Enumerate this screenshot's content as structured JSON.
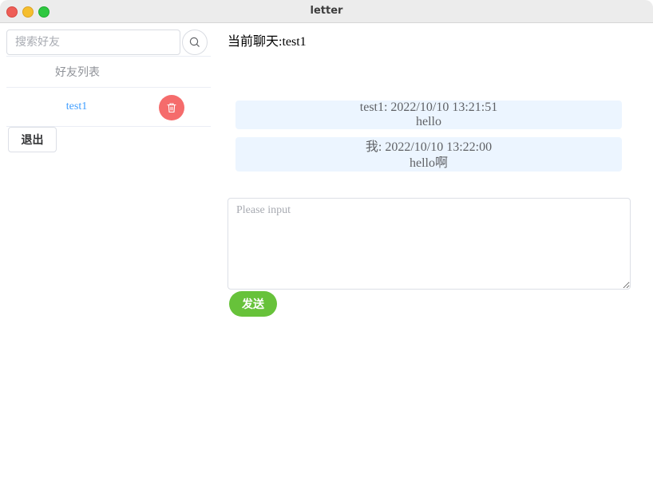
{
  "window": {
    "title": "letter"
  },
  "sidebar": {
    "search": {
      "placeholder": "搜索好友",
      "value": ""
    },
    "search_icon": "search-icon",
    "friends_header": "好友列表",
    "friends": [
      {
        "name": "test1",
        "delete_icon": "trash-icon"
      }
    ],
    "logout_label": "退出"
  },
  "chat": {
    "title": "当前聊天:test1",
    "messages": [
      {
        "meta": "test1: 2022/10/10 13:21:51",
        "content": "hello"
      },
      {
        "meta": "我: 2022/10/10 13:22:00",
        "content": "hello啊"
      }
    ],
    "input": {
      "placeholder": "Please input",
      "value": ""
    },
    "send_label": "发送"
  },
  "colors": {
    "accent_blue": "#409eff",
    "success_green": "#67c23a",
    "danger_red": "#f56c6c",
    "message_bg": "#ecf5ff"
  }
}
